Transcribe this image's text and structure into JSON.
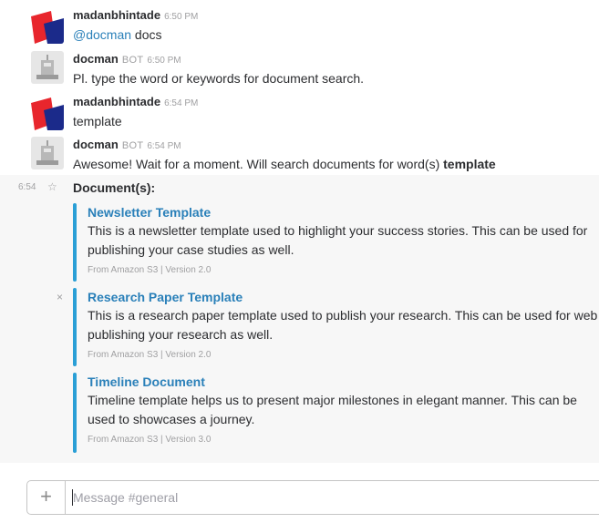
{
  "messages": [
    {
      "author": "madanbhintade",
      "time": "6:50 PM",
      "mention": "@docman",
      "text": " docs",
      "avatar": "user-avatar"
    },
    {
      "author": "docman",
      "bot_tag": "BOT",
      "time": "6:50 PM",
      "text": "Pl. type the word or keywords for document search.",
      "avatar": "bot-avatar"
    },
    {
      "author": "madanbhintade",
      "time": "6:54 PM",
      "text": "template",
      "avatar": "user-avatar"
    },
    {
      "author": "docman",
      "bot_tag": "BOT",
      "time": "6:54 PM",
      "text": "Awesome! Wait for a moment. Will search documents for word(s) ",
      "keyword": "template",
      "avatar": "bot-avatar"
    }
  ],
  "attachments_group": {
    "time": "6:54",
    "star_icon": "☆",
    "dismiss_icon": "×",
    "heading": "Document(s):",
    "items": [
      {
        "title": "Newsletter Template",
        "description": "This is a newsletter template used to highlight your success stories. This can be used for publishing your case studies as well.",
        "footer": "From Amazon S3 | Version 2.0"
      },
      {
        "title": "Research Paper Template",
        "description": "This is a research paper template used to publish your research. This can be used for web publishing your research as well.",
        "footer": "From Amazon S3 | Version 2.0"
      },
      {
        "title": "Timeline Document",
        "description": "Timeline template helps us to present major milestones in elegant manner. This can be used to showcases a journey.",
        "footer": "From Amazon S3 | Version 3.0"
      }
    ]
  },
  "composer": {
    "plus_label": "+",
    "placeholder": "Message #general"
  },
  "colors": {
    "accent_link": "#2a80b9",
    "attachment_bar": "#2a9fd6",
    "user_avatar_red": "#e8262d",
    "user_avatar_blue": "#1b2a8a"
  }
}
